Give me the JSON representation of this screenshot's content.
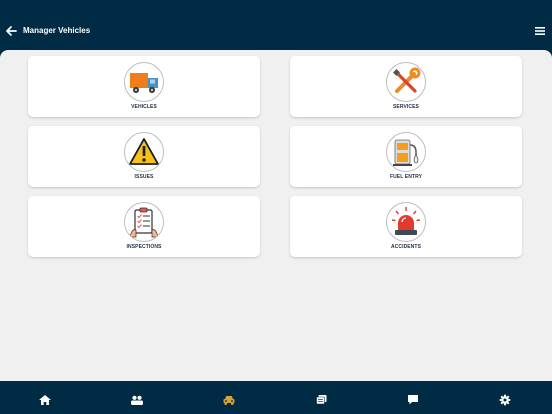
{
  "header": {
    "title": "Manager Vehicles",
    "back_icon": "arrow-left-icon",
    "menu_icon": "hamburger-menu-icon"
  },
  "cards": [
    {
      "label": "VEHICLES",
      "icon": "truck-icon"
    },
    {
      "label": "SERVICES",
      "icon": "wrench-screwdriver-icon"
    },
    {
      "label": "ISSUES",
      "icon": "warning-triangle-icon"
    },
    {
      "label": "FUEL ENTRY",
      "icon": "fuel-pump-icon"
    },
    {
      "label": "INSPECTIONS",
      "icon": "clipboard-checklist-icon"
    },
    {
      "label": "ACCIDENTS",
      "icon": "siren-icon"
    }
  ],
  "tabbar": {
    "active_tab": "car",
    "active_color": "#d4a437",
    "inactive_color": "#ffffff",
    "tabs": [
      "home-icon",
      "people-icon",
      "car-icon",
      "reports-icon",
      "chat-icon",
      "settings-icon"
    ]
  },
  "colors": {
    "navy": "#002b45",
    "background": "#f0f0f0",
    "label": "#1d2f44"
  }
}
